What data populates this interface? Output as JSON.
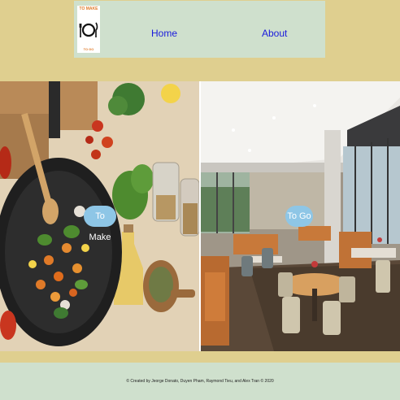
{
  "header": {
    "logo": {
      "top_text": "TO MAKE",
      "bottom_text": "TO GO",
      "icon": "fork-knife-plate-icon",
      "accent_color": "#e07a2a"
    },
    "nav": {
      "home_label": "Home",
      "about_label": "About"
    }
  },
  "main": {
    "left_panel": {
      "image": "cooking-pan-vegetables-photo",
      "button_label": "To Make"
    },
    "right_panel": {
      "image": "restaurant-interior-photo",
      "button_label": "To Go"
    }
  },
  "footer": {
    "credits": "© Created by Jeorge Donato, Duyen Pham, Raymond Tieu, and Alex Tran © 2020"
  },
  "colors": {
    "band": "#dfcf8f",
    "nav_background": "#cfe0cd",
    "link": "#1a1adc",
    "button": "#8ec6e6"
  }
}
